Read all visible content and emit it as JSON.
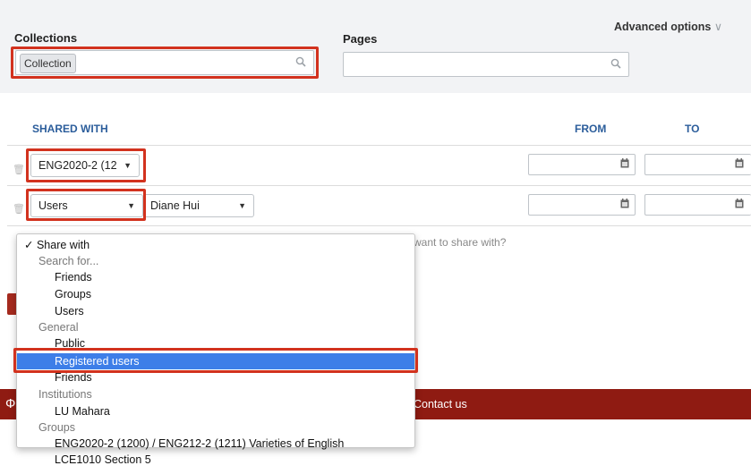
{
  "filters": {
    "advanced_options": "Advanced options",
    "collections_label": "Collections",
    "collection_chip": "Collection",
    "pages_label": "Pages"
  },
  "table": {
    "header_shared_with": "SHARED WITH",
    "header_from": "FROM",
    "header_to": "TO",
    "row1_select": "ENG2020-2 (12",
    "row2_type": "Users",
    "row2_user": "Diane Hui"
  },
  "background": {
    "prompt": "want to share with?",
    "footer_contact": "Contact us"
  },
  "menu": {
    "share_with": "Share with",
    "search_for": "Search for...",
    "friends": "Friends",
    "groups": "Groups",
    "users": "Users",
    "general": "General",
    "public": "Public",
    "registered_users": "Registered users",
    "friends2": "Friends",
    "institutions": "Institutions",
    "lu_mahara": "LU Mahara",
    "groups_heading": "Groups",
    "group1": "ENG2020-2 (1200) / ENG212-2 (1211) Varieties of English",
    "group2": "LCE1010 Section 5"
  },
  "colors": {
    "accent_red": "#d2321e",
    "header_blue": "#2b5d9b",
    "selection_blue": "#3d7ee8",
    "footer_red": "#8f1b12"
  }
}
